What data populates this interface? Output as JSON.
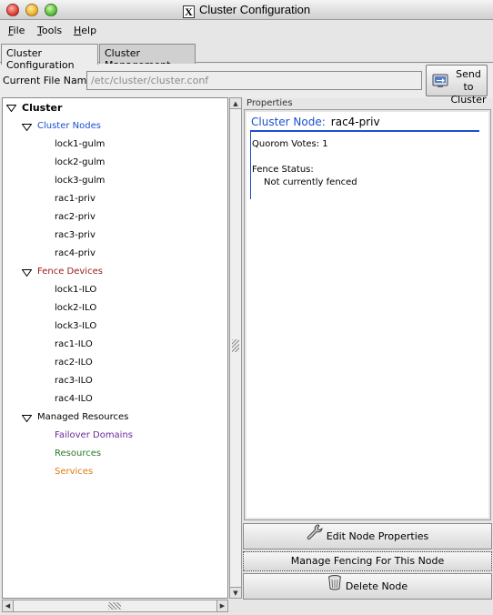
{
  "window": {
    "title": "Cluster Configuration"
  },
  "menubar": {
    "items": [
      "File",
      "Tools",
      "Help"
    ]
  },
  "tabs": [
    {
      "label": "Cluster Configuration",
      "active": true
    },
    {
      "label": "Cluster Management",
      "active": false
    }
  ],
  "file": {
    "label": "Current File Name:",
    "value": "/etc/cluster/cluster.conf",
    "send_button": "Send to\nCluster"
  },
  "tree": {
    "root": "Cluster",
    "cluster_nodes": {
      "label": "Cluster Nodes",
      "color": "#1a4fd0",
      "items": [
        "lock1-gulm",
        "lock2-gulm",
        "lock3-gulm",
        "rac1-priv",
        "rac2-priv",
        "rac3-priv",
        "rac4-priv"
      ]
    },
    "fence_devices": {
      "label": "Fence Devices",
      "color": "#9a1a1a",
      "items": [
        "lock1-ILO",
        "lock2-ILO",
        "lock3-ILO",
        "rac1-ILO",
        "rac2-ILO",
        "rac3-ILO",
        "rac4-ILO"
      ]
    },
    "managed_resources": {
      "label": "Managed Resources",
      "children": [
        {
          "label": "Failover Domains",
          "color": "#6a2a9a"
        },
        {
          "label": "Resources",
          "color": "#2a7a2a"
        },
        {
          "label": "Services",
          "color": "#e07a10"
        }
      ]
    }
  },
  "properties": {
    "section_label": "Properties",
    "node_key": "Cluster Node:",
    "node_value": "rac4-priv",
    "quorum_votes": "Quorom Votes: 1",
    "fence_status_label": "Fence Status:",
    "fence_status_value": "Not currently fenced"
  },
  "actions": {
    "edit": "Edit Node Properties",
    "fencing": "Manage Fencing For This Node",
    "delete": "Delete Node"
  },
  "icons": {
    "send": "send-to-cluster-icon",
    "edit": "wrench-icon",
    "delete": "trash-icon"
  }
}
